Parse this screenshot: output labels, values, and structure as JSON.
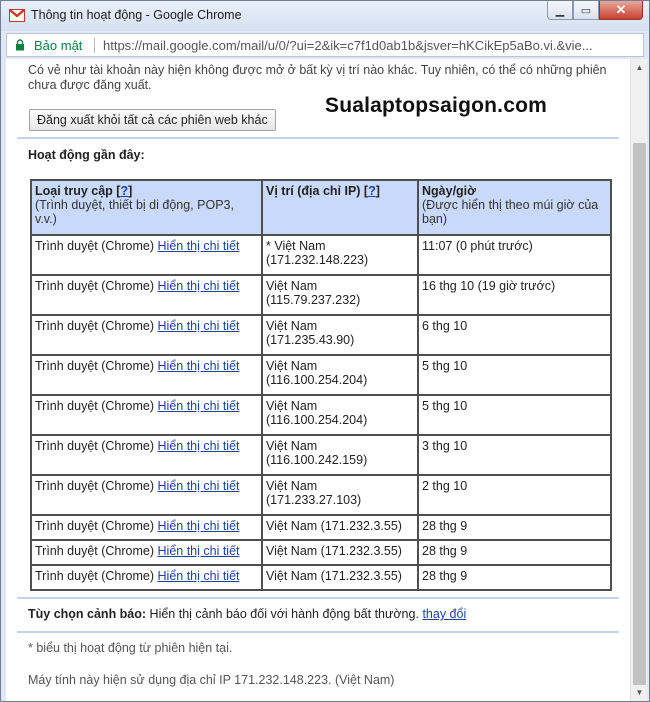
{
  "window": {
    "title": "Thông tin hoạt động - Google Chrome",
    "controls": {
      "minimize": "▁",
      "maximize": "▭",
      "close": "✕"
    }
  },
  "address_bar": {
    "secure_label": "Bảo mật",
    "url": "https://mail.google.com/mail/u/0/?ui=2&ik=c7f1d0ab1b&jsver=hKCikEp5aBo.vi.&vie..."
  },
  "page": {
    "warning_text": "Có vẻ như tài khoản này hiện không được mở ở bất kỳ vị trí nào khác. Tuy nhiên, có thể có những phiên chưa được đăng xuất.",
    "signout_button": "Đăng xuất khỏi tất cả các phiên web khác",
    "watermark": "Sualaptopsaigon.com",
    "recent_activity_heading": "Hoạt động gần đây:",
    "table": {
      "columns": [
        {
          "title": "Loại truy cập [",
          "help": "?",
          "title_end": "]",
          "subtitle": "(Trình duyệt, thiết bị di động, POP3, v.v.)"
        },
        {
          "title": "Vị trí (địa chỉ IP) [",
          "help": "?",
          "title_end": "]",
          "subtitle": ""
        },
        {
          "title": "Ngày/giờ",
          "help": "",
          "title_end": "",
          "subtitle": "(Được hiển thị theo múi giờ của bạn)"
        }
      ],
      "rows": [
        {
          "access": "Trình duyệt (Chrome)",
          "details": "Hiển thị chi tiết",
          "location": "* Việt Nam",
          "ip": "(171.232.148.223)",
          "time": "11:07 (0 phút trước)"
        },
        {
          "access": "Trình duyệt (Chrome)",
          "details": "Hiển thị chi tiết",
          "location": "Việt Nam",
          "ip": "(115.79.237.232)",
          "time": "16 thg 10 (19 giờ trước)"
        },
        {
          "access": "Trình duyệt (Chrome)",
          "details": "Hiển thị chi tiết",
          "location": "Việt Nam",
          "ip": "(171.235.43.90)",
          "time": "6 thg 10"
        },
        {
          "access": "Trình duyệt (Chrome)",
          "details": "Hiển thị chi tiết",
          "location": "Việt Nam",
          "ip": "(116.100.254.204)",
          "time": "5 thg 10"
        },
        {
          "access": "Trình duyệt (Chrome)",
          "details": "Hiển thị chi tiết",
          "location": "Việt Nam",
          "ip": "(116.100.254.204)",
          "time": "5 thg 10"
        },
        {
          "access": "Trình duyệt (Chrome)",
          "details": "Hiển thị chi tiết",
          "location": "Việt Nam",
          "ip": "(116.100.242.159)",
          "time": "3 thg 10"
        },
        {
          "access": "Trình duyệt (Chrome)",
          "details": "Hiển thị chi tiết",
          "location": "Việt Nam",
          "ip": "(171.233.27.103)",
          "time": "2 thg 10"
        },
        {
          "access": "Trình duyệt (Chrome)",
          "details": "Hiển thị chi tiết",
          "location": "Việt Nam (171.232.3.55)",
          "ip": "",
          "time": "28 thg 9"
        },
        {
          "access": "Trình duyệt (Chrome)",
          "details": "Hiển thị chi tiết",
          "location": "Việt Nam (171.232.3.55)",
          "ip": "",
          "time": "28 thg 9"
        },
        {
          "access": "Trình duyệt (Chrome)",
          "details": "Hiển thị chi tiết",
          "location": "Việt Nam (171.232.3.55)",
          "ip": "",
          "time": "28 thg 9"
        }
      ]
    },
    "alert_label": "Tùy chọn cảnh báo:",
    "alert_text": "Hiển thị cảnh báo đối với hành động bất thường.",
    "alert_change": "thay đổi",
    "footnote": "* biểu thị hoạt động từ phiên hiện tại.",
    "ip_info": "Máy tính này hiện sử dụng địa chỉ IP 171.232.148.223. (Việt Nam)"
  },
  "colors": {
    "table_header_bg": "#c9d9f9",
    "link": "#1f3fa8",
    "secure_green": "#0b8043",
    "divider": "#c4d4ea"
  },
  "icons": {
    "tab_icon": "gmail-icon",
    "secure_icon": "lock-icon"
  }
}
